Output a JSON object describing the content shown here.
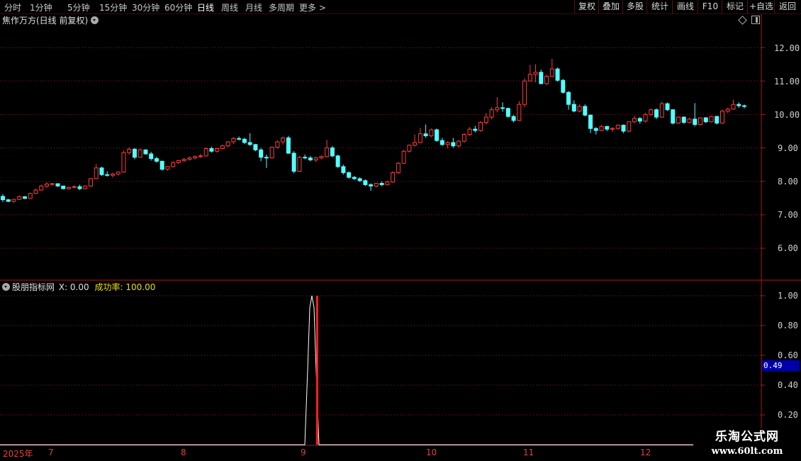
{
  "toolbar": {
    "periods": [
      "分时",
      "1分钟",
      "5分钟",
      "15分钟",
      "30分钟",
      "60分钟",
      "日线",
      "周线",
      "月线",
      "多周期",
      "更多 >"
    ],
    "active_period": "日线",
    "buttons": [
      "复权",
      "叠加",
      "多股",
      "统计",
      "画线",
      "F10",
      "标记",
      "+自选",
      "返回"
    ]
  },
  "main_chart": {
    "title": "焦作万方(日线 前复权)",
    "price_labels": [
      "12.00",
      "11.00",
      "10.00",
      "9.00",
      "8.00",
      "7.00",
      "6.00"
    ]
  },
  "indicator": {
    "name": "股朋指标网",
    "x_text": "X: 0.00",
    "success_label": "成功率:",
    "success_value": "100.00",
    "axis_labels": [
      "1.00",
      "0.80",
      "0.60",
      "0.40",
      "0.20"
    ],
    "current_value": "0.49"
  },
  "date_axis": [
    "2025年",
    "7",
    "8",
    "9",
    "10",
    "11",
    "12"
  ],
  "watermark": {
    "title": "乐淘公式网",
    "url": "www.60lt.com"
  },
  "colors": {
    "up": "#ff3c3c",
    "down": "#54ffff",
    "grid": "#8b1a1a",
    "axis_border": "#b01818",
    "indicator_line": "#ffffff",
    "signal_bar": "#ff2020",
    "success_text": "#e8e000"
  },
  "chart_data": {
    "type": "candlestick",
    "ylim": [
      5.3,
      12.6
    ],
    "candles": [
      [
        7.55,
        7.62,
        7.38,
        7.45
      ],
      [
        7.45,
        7.47,
        7.38,
        7.4
      ],
      [
        7.4,
        7.48,
        7.36,
        7.46
      ],
      [
        7.46,
        7.58,
        7.44,
        7.54
      ],
      [
        7.54,
        7.56,
        7.47,
        7.49
      ],
      [
        7.49,
        7.66,
        7.48,
        7.64
      ],
      [
        7.64,
        7.78,
        7.62,
        7.74
      ],
      [
        7.74,
        7.9,
        7.72,
        7.86
      ],
      [
        7.86,
        7.98,
        7.8,
        7.92
      ],
      [
        7.92,
        7.95,
        7.88,
        7.93
      ],
      [
        7.93,
        7.94,
        7.83,
        7.86
      ],
      [
        7.86,
        7.87,
        7.76,
        7.78
      ],
      [
        7.78,
        7.84,
        7.76,
        7.82
      ],
      [
        7.82,
        7.88,
        7.8,
        7.84
      ],
      [
        7.84,
        7.9,
        7.74,
        7.78
      ],
      [
        7.78,
        7.88,
        7.76,
        7.86
      ],
      [
        7.86,
        8.1,
        7.84,
        8.08
      ],
      [
        8.08,
        8.52,
        8.06,
        8.4
      ],
      [
        8.4,
        8.44,
        8.16,
        8.2
      ],
      [
        8.2,
        8.3,
        8.14,
        8.18
      ],
      [
        8.18,
        8.26,
        8.12,
        8.22
      ],
      [
        8.22,
        8.3,
        8.18,
        8.28
      ],
      [
        8.28,
        8.92,
        8.26,
        8.86
      ],
      [
        8.86,
        9.02,
        8.8,
        8.96
      ],
      [
        8.96,
        9.0,
        8.66,
        8.72
      ],
      [
        8.72,
        8.98,
        8.7,
        8.94
      ],
      [
        8.94,
        8.96,
        8.8,
        8.82
      ],
      [
        8.82,
        8.88,
        8.62,
        8.68
      ],
      [
        8.68,
        8.74,
        8.56,
        8.6
      ],
      [
        8.6,
        8.62,
        8.32,
        8.36
      ],
      [
        8.36,
        8.46,
        8.32,
        8.44
      ],
      [
        8.44,
        8.6,
        8.42,
        8.56
      ],
      [
        8.56,
        8.64,
        8.52,
        8.62
      ],
      [
        8.62,
        8.7,
        8.58,
        8.66
      ],
      [
        8.66,
        8.74,
        8.62,
        8.7
      ],
      [
        8.7,
        8.78,
        8.66,
        8.74
      ],
      [
        8.74,
        8.82,
        8.7,
        8.76
      ],
      [
        8.76,
        9.02,
        8.74,
        8.98
      ],
      [
        8.98,
        9.04,
        8.86,
        8.9
      ],
      [
        8.9,
        9.0,
        8.86,
        8.98
      ],
      [
        8.98,
        9.1,
        8.96,
        9.06
      ],
      [
        9.06,
        9.2,
        9.02,
        9.18
      ],
      [
        9.18,
        9.32,
        9.12,
        9.28
      ],
      [
        9.28,
        9.34,
        9.22,
        9.26
      ],
      [
        9.26,
        9.3,
        9.12,
        9.16
      ],
      [
        9.16,
        9.44,
        9.06,
        9.1
      ],
      [
        9.1,
        9.12,
        8.9,
        8.94
      ],
      [
        8.94,
        9.0,
        8.6,
        8.72
      ],
      [
        8.72,
        8.8,
        8.4,
        8.7
      ],
      [
        8.7,
        9.04,
        8.68,
        9.02
      ],
      [
        9.02,
        9.22,
        8.98,
        9.18
      ],
      [
        9.18,
        9.34,
        9.1,
        9.3
      ],
      [
        9.3,
        9.36,
        8.82,
        8.84
      ],
      [
        8.84,
        8.9,
        8.24,
        8.3
      ],
      [
        8.3,
        8.76,
        8.28,
        8.72
      ],
      [
        8.72,
        8.8,
        8.66,
        8.7
      ],
      [
        8.7,
        8.76,
        8.6,
        8.64
      ],
      [
        8.64,
        8.74,
        8.58,
        8.7
      ],
      [
        8.7,
        8.78,
        8.66,
        8.74
      ],
      [
        8.74,
        9.24,
        8.72,
        9.0
      ],
      [
        9.0,
        9.06,
        8.72,
        8.76
      ],
      [
        8.76,
        8.8,
        8.4,
        8.44
      ],
      [
        8.44,
        8.5,
        8.2,
        8.26
      ],
      [
        8.26,
        8.3,
        8.08,
        8.12
      ],
      [
        8.12,
        8.16,
        8.04,
        8.08
      ],
      [
        8.08,
        8.12,
        7.98,
        8.02
      ],
      [
        8.02,
        8.06,
        7.86,
        7.9
      ],
      [
        7.9,
        7.94,
        7.72,
        7.86
      ],
      [
        7.86,
        7.96,
        7.82,
        7.94
      ],
      [
        7.94,
        8.0,
        7.86,
        7.9
      ],
      [
        7.9,
        8.02,
        7.88,
        7.98
      ],
      [
        7.98,
        8.3,
        7.96,
        8.26
      ],
      [
        8.26,
        8.58,
        8.22,
        8.54
      ],
      [
        8.54,
        8.94,
        8.52,
        8.9
      ],
      [
        8.9,
        9.1,
        8.86,
        9.08
      ],
      [
        9.08,
        9.4,
        9.04,
        9.16
      ],
      [
        9.16,
        9.6,
        9.14,
        9.42
      ],
      [
        9.42,
        9.7,
        9.3,
        9.36
      ],
      [
        9.36,
        9.58,
        9.32,
        9.54
      ],
      [
        9.54,
        9.58,
        9.18,
        9.22
      ],
      [
        9.22,
        9.3,
        9.06,
        9.1
      ],
      [
        9.1,
        9.2,
        8.98,
        9.16
      ],
      [
        9.16,
        9.3,
        9.0,
        9.06
      ],
      [
        9.06,
        9.24,
        9.0,
        9.2
      ],
      [
        9.2,
        9.44,
        9.16,
        9.4
      ],
      [
        9.4,
        9.62,
        9.36,
        9.56
      ],
      [
        9.56,
        9.66,
        9.46,
        9.52
      ],
      [
        9.52,
        9.8,
        9.48,
        9.76
      ],
      [
        9.76,
        10.04,
        9.7,
        9.92
      ],
      [
        9.92,
        10.22,
        9.86,
        10.14
      ],
      [
        10.14,
        10.52,
        10.06,
        10.2
      ],
      [
        10.2,
        10.36,
        10.08,
        10.18
      ],
      [
        10.18,
        10.2,
        9.9,
        9.94
      ],
      [
        9.94,
        9.98,
        9.76,
        9.82
      ],
      [
        9.82,
        10.4,
        9.8,
        10.3
      ],
      [
        10.3,
        11.08,
        10.22,
        11.0
      ],
      [
        11.0,
        11.48,
        10.98,
        11.2
      ],
      [
        11.2,
        11.5,
        10.96,
        11.26
      ],
      [
        11.26,
        11.34,
        10.9,
        10.92
      ],
      [
        10.92,
        11.2,
        10.88,
        11.14
      ],
      [
        11.14,
        11.66,
        11.12,
        11.36
      ],
      [
        11.36,
        11.4,
        10.98,
        11.02
      ],
      [
        11.02,
        11.06,
        10.62,
        10.66
      ],
      [
        10.66,
        10.7,
        10.14,
        10.3
      ],
      [
        10.3,
        10.42,
        10.06,
        10.1
      ],
      [
        10.1,
        10.3,
        10.06,
        10.24
      ],
      [
        10.24,
        10.3,
        9.94,
        9.98
      ],
      [
        9.98,
        10.0,
        9.44,
        9.58
      ],
      [
        9.58,
        9.62,
        9.4,
        9.52
      ],
      [
        9.52,
        9.68,
        9.5,
        9.64
      ],
      [
        9.64,
        9.66,
        9.5,
        9.56
      ],
      [
        9.56,
        9.62,
        9.48,
        9.58
      ],
      [
        9.58,
        9.7,
        9.54,
        9.68
      ],
      [
        9.68,
        9.7,
        9.44,
        9.5
      ],
      [
        9.5,
        9.8,
        9.46,
        9.78
      ],
      [
        9.78,
        9.96,
        9.74,
        9.88
      ],
      [
        9.88,
        9.92,
        9.72,
        9.8
      ],
      [
        9.8,
        10.04,
        9.76,
        10.0
      ],
      [
        10.0,
        10.18,
        9.96,
        10.14
      ],
      [
        10.14,
        10.18,
        9.86,
        9.92
      ],
      [
        9.92,
        10.38,
        9.9,
        10.32
      ],
      [
        10.32,
        10.36,
        10.1,
        10.14
      ],
      [
        10.14,
        10.16,
        9.7,
        9.74
      ],
      [
        9.74,
        9.94,
        9.72,
        9.92
      ],
      [
        9.92,
        9.94,
        9.72,
        9.76
      ],
      [
        9.76,
        9.9,
        9.74,
        9.86
      ],
      [
        9.86,
        10.34,
        9.64,
        9.7
      ],
      [
        9.7,
        9.92,
        9.68,
        9.9
      ],
      [
        9.9,
        9.92,
        9.74,
        9.78
      ],
      [
        9.78,
        9.96,
        9.76,
        9.94
      ],
      [
        9.94,
        9.96,
        9.7,
        9.74
      ],
      [
        9.74,
        10.14,
        9.72,
        10.1
      ],
      [
        10.1,
        10.2,
        10.04,
        10.16
      ],
      [
        10.16,
        10.44,
        10.14,
        10.3
      ],
      [
        10.3,
        10.36,
        10.2,
        10.26
      ],
      [
        10.26,
        10.3,
        10.18,
        10.24
      ]
    ],
    "indicator_line": {
      "ylim": [
        0,
        1.1
      ],
      "values_note": "zero except spike to 1.00 at 2025-09-03 window",
      "spike": [
        0,
        0.25,
        0.6,
        0.95,
        1.0,
        0.95,
        0.6,
        0.25,
        0
      ]
    },
    "signal_bar": {
      "value": 1.0
    }
  }
}
